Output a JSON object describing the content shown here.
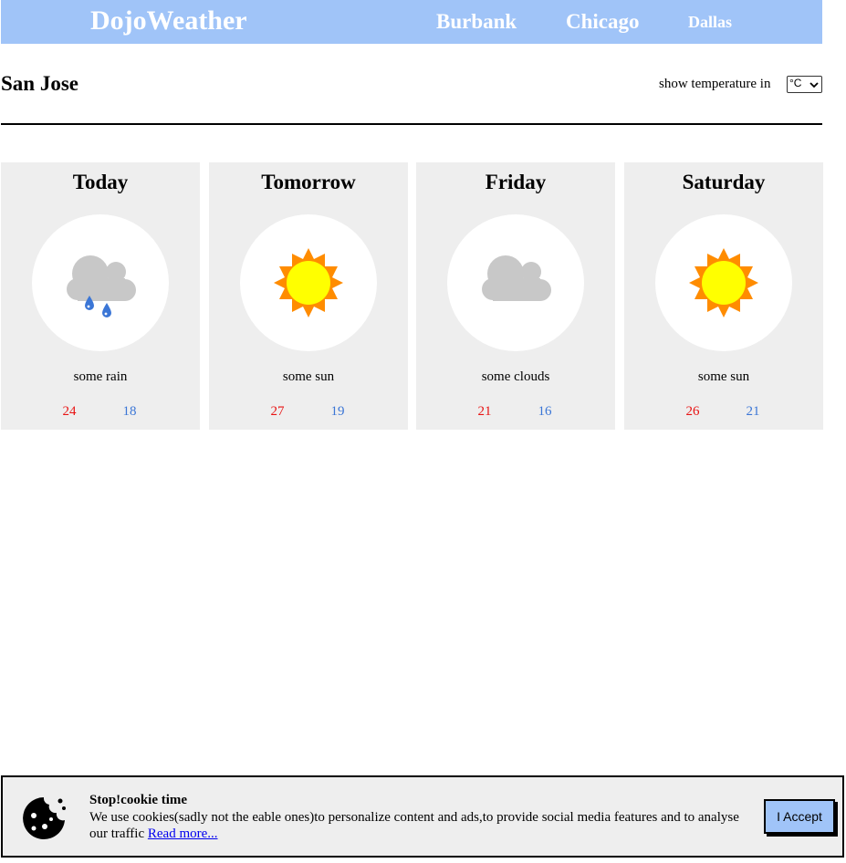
{
  "header": {
    "logo": "DojoWeather",
    "nav": [
      "Burbank",
      "Chicago",
      "Dallas"
    ]
  },
  "location": {
    "city": "San Jose",
    "unit_label": "show temperature in",
    "unit_selected": "°C"
  },
  "forecast": [
    {
      "day": "Today",
      "icon": "rain-cloud-icon",
      "desc": "some rain",
      "high": "24",
      "low": "18"
    },
    {
      "day": "Tomorrow",
      "icon": "sun-icon",
      "desc": "some sun",
      "high": "27",
      "low": "19"
    },
    {
      "day": "Friday",
      "icon": "cloud-icon",
      "desc": "some clouds",
      "high": "21",
      "low": "16"
    },
    {
      "day": "Saturday",
      "icon": "sun-icon",
      "desc": "some sun",
      "high": "26",
      "low": "21"
    }
  ],
  "cookie": {
    "title": "Stop!cookie time",
    "text": "We use cookies(sadly not the eable ones)to personalize content and ads,to provide social media features and to analyse our traffic",
    "link": "Read more...",
    "button": "I Accept"
  },
  "colors": {
    "header_bg": "#a0c4f8",
    "card_bg": "#eeeeee",
    "high_temp": "#e81313",
    "low_temp": "#3b76d6",
    "sun": "#ffff00",
    "sun_rays": "#ff8c00",
    "cloud": "#c8c8c8",
    "rain": "#3b76d6"
  }
}
